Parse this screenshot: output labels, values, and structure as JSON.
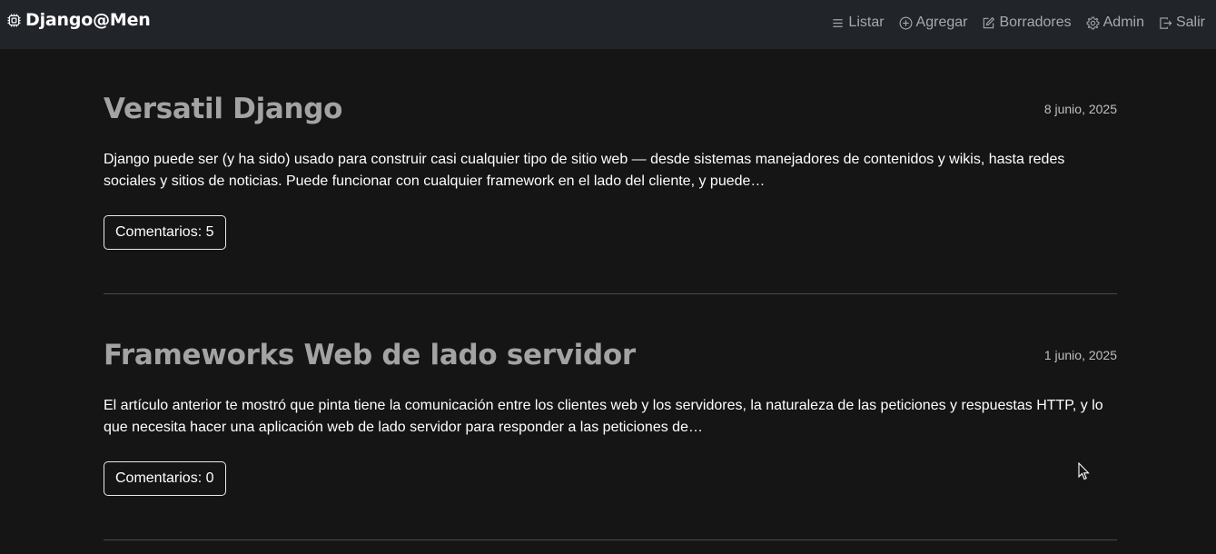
{
  "navbar": {
    "brand": "Django@Men",
    "brand_icon": "cpu-icon",
    "items": [
      {
        "label": "Listar",
        "icon": "list-icon"
      },
      {
        "label": "Agregar",
        "icon": "plus-circle-icon"
      },
      {
        "label": "Borradores",
        "icon": "pencil-square-icon"
      },
      {
        "label": "Admin",
        "icon": "gear-icon"
      },
      {
        "label": "Salir",
        "icon": "logout-icon"
      }
    ]
  },
  "posts": [
    {
      "title": "Versatil Django",
      "date": "8 junio, 2025",
      "excerpt": "Django puede ser (y ha sido) usado para construir casi cualquier tipo de sitio web — desde sistemas manejadores de contenidos y wikis, hasta redes sociales y sitios de noticias. Puede funcionar con cualquier framework en el lado del cliente, y puede…",
      "comments": "Comentarios: 5"
    },
    {
      "title": "Frameworks Web de lado servidor",
      "date": "1 junio, 2025",
      "excerpt": "El artículo anterior te mostró que pinta tiene la comunicación entre los clientes web y los servidores, la naturaleza de las peticiones y respuestas HTTP, y lo que necesita hacer una aplicación web de lado servidor para responder a las peticiones de…",
      "comments": "Comentarios: 0"
    }
  ],
  "colors": {
    "background": "#151515",
    "navbar": "#212529",
    "title": "#a3a3a3",
    "nav_text": "#a6a9ac"
  }
}
